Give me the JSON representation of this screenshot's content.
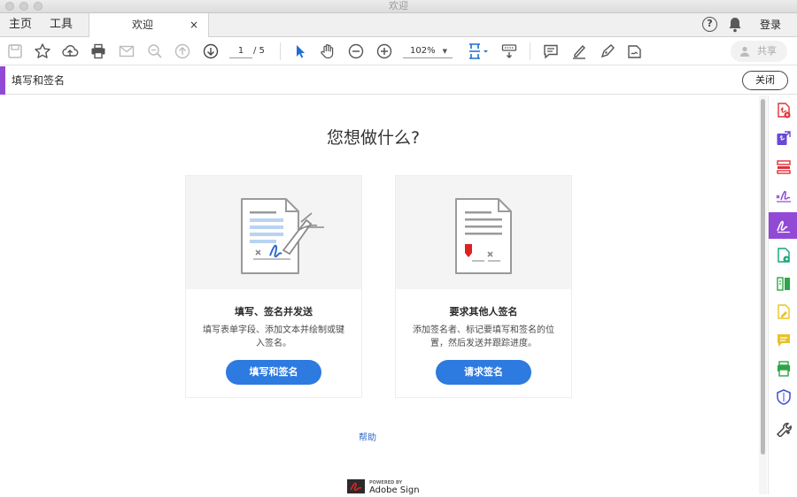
{
  "window": {
    "title": "欢迎"
  },
  "tabs": {
    "home": "主页",
    "tools": "工具",
    "document": "欢迎",
    "close_glyph": "×"
  },
  "header_right": {
    "help": "?",
    "login": "登录"
  },
  "toolbar": {
    "page_current": "1",
    "page_total": "/ 5",
    "zoom": "102%",
    "share": "共享"
  },
  "tool_header": {
    "title": "填写和签名",
    "close": "关闭"
  },
  "main": {
    "heading": "您想做什么?",
    "cards": [
      {
        "title": "填写、签名并发送",
        "description": "填写表单字段、添加文本并绘制或键入签名。",
        "button": "填写和签名"
      },
      {
        "title": "要求其他人签名",
        "description": "添加签名者、标记要填写和签名的位置，然后发送并跟踪进度。",
        "button": "请求签名"
      }
    ],
    "help_link": "帮助",
    "powered_by": "POWERED BY",
    "brand": "Adobe Sign"
  },
  "rail_icons": [
    "create-pdf-icon",
    "export-pdf-icon",
    "organize-pages-icon",
    "fill-sign-icon",
    "send-for-signature-icon",
    "combine-files-icon",
    "compare-files-icon",
    "edit-pdf-icon",
    "comment-icon",
    "print-production-icon",
    "protect-icon",
    "more-tools-icon"
  ],
  "colors": {
    "accent_purple": "#9249d6",
    "button_blue": "#2d7ae0",
    "link_blue": "#2d6bc8",
    "signature_red": "#e02020"
  }
}
